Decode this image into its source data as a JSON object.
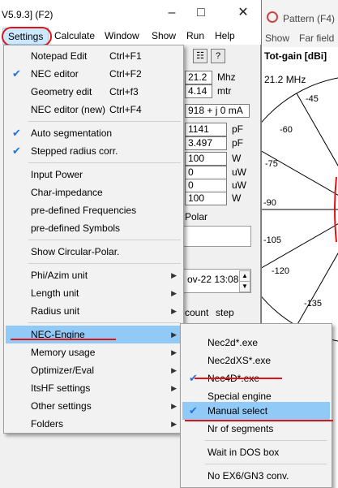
{
  "main": {
    "title": "V5.9.3]  (F2)",
    "menus": [
      "Settings",
      "Calculate",
      "Window",
      "Show",
      "Run",
      "Help"
    ],
    "fields": {
      "freq": "21.2",
      "freq_unit": "Mhz",
      "wavelength": "4.14",
      "wavelength_unit": "mtr",
      "current": "918 + j 0 mA",
      "cap1": "1141",
      "cap1_unit": "pF",
      "cap2": "3.497",
      "cap2_unit": "pF",
      "pw1": "100",
      "pw1_unit": "W",
      "pw2": "0",
      "pw2_unit": "uW",
      "pw3": "0",
      "pw3_unit": "uW",
      "pw4": "100",
      "pw4_unit": "W",
      "polar_label": "Polar",
      "date": "ov-22 13:08",
      "count_label": "count",
      "step_label": "step"
    }
  },
  "pattern": {
    "title": "Pattern  (F4)",
    "menus": [
      "Show",
      "Far field"
    ],
    "header": "Tot-gain [dBi]",
    "freq": "21.2 MHz",
    "scale": [
      "-45",
      "-60",
      "-75",
      "-90",
      "-105",
      "-120",
      "-135"
    ]
  },
  "settings_menu": {
    "items": [
      {
        "label": "Notepad Edit",
        "shortcut": "Ctrl+F1",
        "checked": false
      },
      {
        "label": "NEC editor",
        "shortcut": "Ctrl+F2",
        "checked": true
      },
      {
        "label": "Geometry edit",
        "shortcut": "Ctrl+f3",
        "checked": false
      },
      {
        "label": "NEC editor (new)",
        "shortcut": "Ctrl+F4",
        "checked": false
      },
      {
        "label": "Auto segmentation",
        "checked": true
      },
      {
        "label": "Stepped radius corr.",
        "checked": true
      },
      {
        "label": "Input Power"
      },
      {
        "label": "Char-impedance"
      },
      {
        "label": "pre-defined Frequencies"
      },
      {
        "label": "pre-defined Symbols"
      },
      {
        "label": "Show Circular-Polar."
      },
      {
        "label": "Phi/Azim unit",
        "submenu": true
      },
      {
        "label": "Length unit",
        "submenu": true
      },
      {
        "label": "Radius unit",
        "submenu": true
      },
      {
        "label": "NEC-Engine",
        "submenu": true,
        "highlighted": true
      },
      {
        "label": "Memory usage",
        "submenu": true
      },
      {
        "label": "Optimizer/Eval",
        "submenu": true
      },
      {
        "label": "ItsHF settings",
        "submenu": true
      },
      {
        "label": "Other settings",
        "submenu": true
      },
      {
        "label": "Folders",
        "submenu": true
      }
    ]
  },
  "engine_menu": {
    "items": [
      {
        "label": "Nec2d*.exe",
        "checked": false
      },
      {
        "label": "Nec2dXS*.exe",
        "checked": false
      },
      {
        "label": "Nec4D*.exe",
        "checked": true
      },
      {
        "label": "Special engine",
        "checked": false
      },
      {
        "label": "Manual select",
        "checked": true,
        "highlighted": true
      },
      {
        "label": "Nr of segments",
        "checked": false
      },
      {
        "label": "Wait in DOS box",
        "checked": false
      },
      {
        "label": "No EX6/GN3 conv.",
        "checked": false
      }
    ]
  },
  "colors": {
    "highlight": "#91c9f7",
    "menu_active": "#cce8ff",
    "annotation_red": "#e01414",
    "check": "#1a73e8"
  }
}
